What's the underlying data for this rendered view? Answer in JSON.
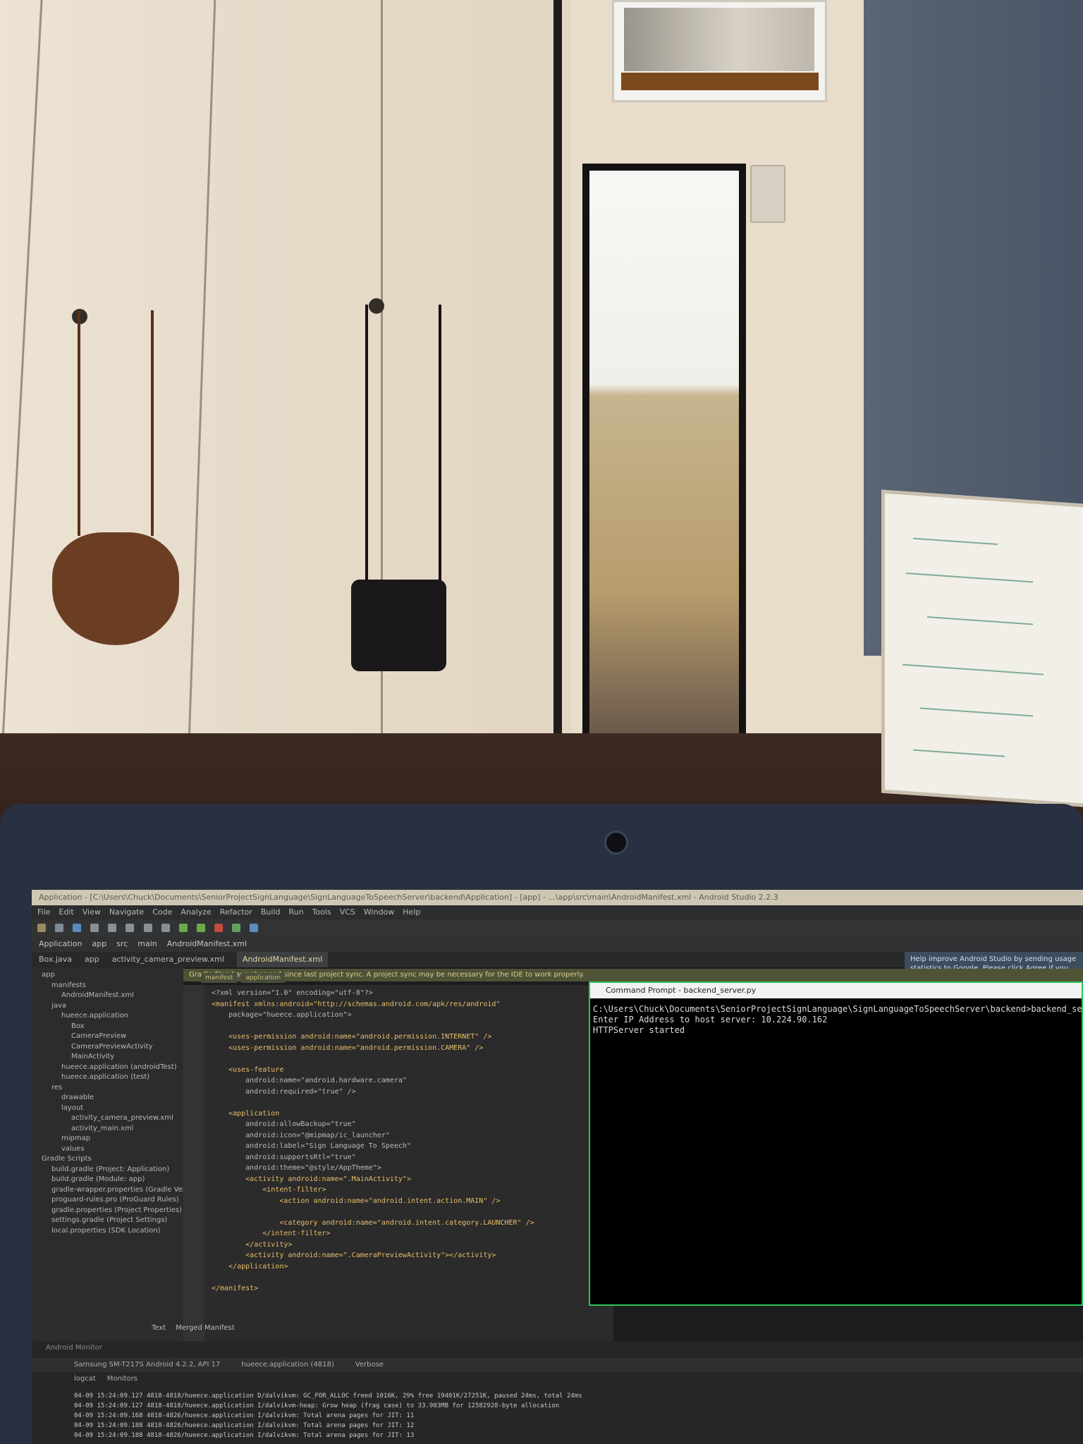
{
  "ide": {
    "title": "Application - [C:\\Users\\Chuck\\Documents\\SeniorProjectSignLanguage\\SignLanguageToSpeechServer\\backend\\Application] - [app] - ...\\app\\src\\main\\AndroidManifest.xml - Android Studio 2.2.3",
    "menu": [
      "File",
      "Edit",
      "View",
      "Navigate",
      "Code",
      "Analyze",
      "Refactor",
      "Build",
      "Run",
      "Tools",
      "VCS",
      "Window",
      "Help"
    ],
    "breadcrumb": [
      "Application",
      "app",
      "src",
      "main",
      "AndroidManifest.xml"
    ],
    "tabs": [
      "Box.java",
      "app",
      "activity_camera_preview.xml",
      "AndroidManifest.xml"
    ],
    "active_tab": "AndroidManifest.xml",
    "gradle_notice": "Gradle files have changed since last project sync. A project sync may be necessary for the IDE to work properly.",
    "help_notice": "Help improve Android Studio by sending usage statistics to Google. Please click Agree if you want to help make Android Studio better or Don't agree otherwise. more...",
    "sub_tabs": [
      "manifest",
      "application"
    ],
    "bottom_tabs": [
      "Text",
      "Merged Manifest"
    ],
    "project_tree": [
      {
        "label": "app",
        "indent": 1
      },
      {
        "label": "manifests",
        "indent": 2
      },
      {
        "label": "AndroidManifest.xml",
        "indent": 3
      },
      {
        "label": "java",
        "indent": 2
      },
      {
        "label": "hueece.application",
        "indent": 3
      },
      {
        "label": "Box",
        "indent": 4
      },
      {
        "label": "CameraPreview",
        "indent": 4
      },
      {
        "label": "CameraPreviewActivity",
        "indent": 4
      },
      {
        "label": "MainActivity",
        "indent": 4
      },
      {
        "label": "hueece.application (androidTest)",
        "indent": 3
      },
      {
        "label": "hueece.application (test)",
        "indent": 3
      },
      {
        "label": "res",
        "indent": 2
      },
      {
        "label": "drawable",
        "indent": 3
      },
      {
        "label": "layout",
        "indent": 3
      },
      {
        "label": "activity_camera_preview.xml",
        "indent": 4
      },
      {
        "label": "activity_main.xml",
        "indent": 4
      },
      {
        "label": "mipmap",
        "indent": 3
      },
      {
        "label": "values",
        "indent": 3
      },
      {
        "label": "Gradle Scripts",
        "indent": 1
      },
      {
        "label": "build.gradle (Project: Application)",
        "indent": 2
      },
      {
        "label": "build.gradle (Module: app)",
        "indent": 2
      },
      {
        "label": "gradle-wrapper.properties (Gradle Version)",
        "indent": 2
      },
      {
        "label": "proguard-rules.pro (ProGuard Rules)",
        "indent": 2
      },
      {
        "label": "gradle.properties (Project Properties)",
        "indent": 2
      },
      {
        "label": "settings.gradle (Project Settings)",
        "indent": 2
      },
      {
        "label": "local.properties (SDK Location)",
        "indent": 2
      }
    ],
    "code": [
      "<?xml version=\"1.0\" encoding=\"utf-8\"?>",
      "<manifest xmlns:android=\"http://schemas.android.com/apk/res/android\"",
      "    package=\"hueece.application\">",
      "",
      "    <uses-permission android:name=\"android.permission.INTERNET\" />",
      "    <uses-permission android:name=\"android.permission.CAMERA\" />",
      "",
      "    <uses-feature",
      "        android:name=\"android.hardware.camera\"",
      "        android:required=\"true\" />",
      "",
      "    <application",
      "        android:allowBackup=\"true\"",
      "        android:icon=\"@mipmap/ic_launcher\"",
      "        android:label=\"Sign Language To Speech\"",
      "        android:supportsRtl=\"true\"",
      "        android:theme=\"@style/AppTheme\">",
      "        <activity android:name=\".MainActivity\">",
      "            <intent-filter>",
      "                <action android:name=\"android.intent.action.MAIN\" />",
      "",
      "                <category android:name=\"android.intent.category.LAUNCHER\" />",
      "            </intent-filter>",
      "        </activity>",
      "        <activity android:name=\".CameraPreviewActivity\"></activity>",
      "    </application>",
      "",
      "</manifest>"
    ],
    "monitor": {
      "title": "Android Monitor",
      "device": "Samsung SM-T217S Android 4.2.2, API 17",
      "process": "hueece.application (4818)",
      "tabs": [
        "logcat",
        "Monitors"
      ],
      "level": "Verbose",
      "logs": [
        "04-09 15:24:09.127 4818-4818/hueece.application D/dalvikvm: GC_FOR_ALLOC freed 1016K, 29% free 19401K/27251K, paused 24ms, total 24ms",
        "04-09 15:24:09.127 4818-4818/hueece.application I/dalvikvm-heap: Grow heap (frag case) to 33.903MB for 12582928-byte allocation",
        "04-09 15:24:09.168 4818-4826/hueece.application I/dalvikvm: Total arena pages for JIT: 11",
        "04-09 15:24:09.188 4818-4826/hueece.application I/dalvikvm: Total arena pages for JIT: 12",
        "04-09 15:24:09.188 4818-4826/hueece.application I/dalvikvm: Total arena pages for JIT: 13"
      ]
    }
  },
  "cmd": {
    "title": "Command Prompt - backend_server.py",
    "lines": [
      "C:\\Users\\Chuck\\Documents\\SeniorProjectSignLanguage\\SignLanguageToSpeechServer\\backend>backend_server.py",
      "Enter IP Address to host server: 10.224.90.162",
      "HTTPServer started"
    ]
  },
  "colors": {
    "wall": "#e8dccb",
    "closet": "#e7dccb",
    "carpet": "#3c2a22",
    "blue_wall": "#536071",
    "laptop": "#283041",
    "cmd_border": "#2ec45a"
  }
}
